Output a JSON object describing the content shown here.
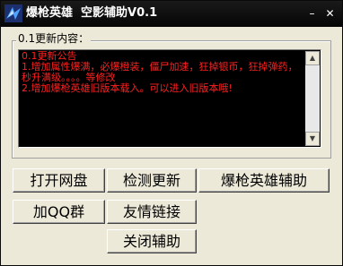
{
  "window": {
    "title": "爆枪英雄  空影辅助V0.1",
    "minimize_glyph": "–",
    "close_glyph": "✕",
    "icon": "app-logo-icon"
  },
  "group": {
    "legend": "0.1更新内容：",
    "log_lines": [
      "0.1更新公告",
      "1.增加属性爆满，必爆橙装，僵尸加速，狂掉银币，狂掉弹药，秒升满级。。。。等修改",
      "2.增加爆枪英雄旧版本载入。可以进入旧版本哦!"
    ],
    "text_color": "#ff2020",
    "background_color": "#000000"
  },
  "buttons": {
    "open_netdisk": "打开网盘",
    "check_update": "检测更新",
    "game_assist": "爆枪英雄辅助",
    "join_qq_group": "加QQ群",
    "friend_links": "友情链接",
    "close_assist": "关闭辅助"
  }
}
